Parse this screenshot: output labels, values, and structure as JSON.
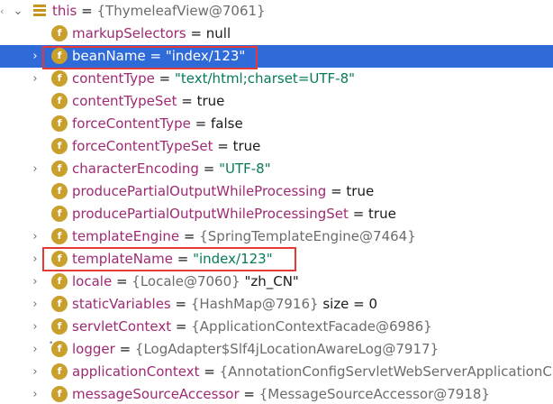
{
  "tree": {
    "root": {
      "name": "this",
      "op": " = ",
      "value": "{ThymeleafView@7061}"
    },
    "rows": [
      {
        "name": "markupSelectors",
        "op": " = ",
        "value": "null",
        "value_type": "plain",
        "expandable": false,
        "selected": false
      },
      {
        "name": "beanName",
        "op": " = ",
        "value": "\"index/123\"",
        "value_type": "string",
        "expandable": true,
        "selected": true
      },
      {
        "name": "contentType",
        "op": " = ",
        "value": "\"text/html;charset=UTF-8\"",
        "value_type": "string",
        "expandable": true,
        "selected": false
      },
      {
        "name": "contentTypeSet",
        "op": " = ",
        "value": "true",
        "value_type": "plain",
        "expandable": false,
        "selected": false
      },
      {
        "name": "forceContentType",
        "op": " = ",
        "value": "false",
        "value_type": "plain",
        "expandable": false,
        "selected": false
      },
      {
        "name": "forceContentTypeSet",
        "op": " = ",
        "value": "true",
        "value_type": "plain",
        "expandable": false,
        "selected": false
      },
      {
        "name": "characterEncoding",
        "op": " = ",
        "value": "\"UTF-8\"",
        "value_type": "string",
        "expandable": true,
        "selected": false
      },
      {
        "name": "producePartialOutputWhileProcessing",
        "op": " = ",
        "value": "true",
        "value_type": "plain",
        "expandable": false,
        "selected": false
      },
      {
        "name": "producePartialOutputWhileProcessingSet",
        "op": " = ",
        "value": "true",
        "value_type": "plain",
        "expandable": false,
        "selected": false
      },
      {
        "name": "templateEngine",
        "op": " = ",
        "value": "{SpringTemplateEngine@7464}",
        "value_type": "object",
        "expandable": true,
        "selected": false
      },
      {
        "name": "templateName",
        "op": " = ",
        "value": "\"index/123\"",
        "value_type": "string",
        "expandable": true,
        "selected": false
      },
      {
        "name": "locale",
        "op": " = ",
        "value": "{Locale@7060}",
        "value_extra": " \"zh_CN\"",
        "value_type": "object",
        "expandable": true,
        "selected": false
      },
      {
        "name": "staticVariables",
        "op": " = ",
        "value": "{HashMap@7916}",
        "value_extra": "  size = 0",
        "value_type": "object",
        "expandable": true,
        "selected": false
      },
      {
        "name": "servletContext",
        "op": " = ",
        "value": "{ApplicationContextFacade@6986}",
        "value_type": "object",
        "expandable": true,
        "selected": false
      },
      {
        "name": "logger",
        "op": " = ",
        "value": "{LogAdapter$Slf4jLocationAwareLog@7917}",
        "value_type": "object",
        "expandable": true,
        "selected": false,
        "locked": true
      },
      {
        "name": "applicationContext",
        "op": " = ",
        "value": "{AnnotationConfigServletWebServerApplicationC",
        "value_type": "object",
        "expandable": true,
        "selected": false
      },
      {
        "name": "messageSourceAccessor",
        "op": " = ",
        "value": "{MessageSourceAccessor@7918}",
        "value_type": "object",
        "expandable": true,
        "selected": false
      }
    ]
  },
  "icons": {
    "field": "f",
    "expand": "›",
    "collapse": "⌄",
    "gutter": "‹"
  },
  "colors": {
    "selection": "#2f6bd8",
    "field_name": "#9e2a73",
    "string_value": "#087a5b",
    "object_value": "#6c6c6c",
    "field_icon": "#c9a02b",
    "highlight_box": "#e53935"
  }
}
